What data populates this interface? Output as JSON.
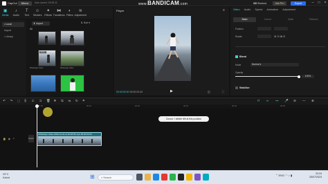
{
  "app": {
    "logo_label": "CapCut",
    "menu_label": "Menu",
    "autosave": "Auto saved: 23:05:11"
  },
  "watermark": {
    "prefix": "www.",
    "main": "BANDICAM",
    "suffix": ".com"
  },
  "header": {
    "shortcut_label": "Shortcut",
    "join_pro_label": "Join Pro",
    "export_label": "Export"
  },
  "media_tabs": [
    {
      "label": "Media",
      "icon": "media-icon",
      "glyph": "▣"
    },
    {
      "label": "Audio",
      "icon": "audio-icon",
      "glyph": "♪"
    },
    {
      "label": "Text",
      "icon": "text-icon",
      "glyph": "T"
    },
    {
      "label": "Stickers",
      "icon": "sticker-icon",
      "glyph": "☺"
    },
    {
      "label": "Effects",
      "icon": "effects-icon",
      "glyph": "✦"
    },
    {
      "label": "Transitions",
      "icon": "transition-icon",
      "glyph": "⧓"
    },
    {
      "label": "Filters",
      "icon": "filter-icon",
      "glyph": "◐"
    },
    {
      "label": "Adjustment",
      "icon": "adjust-icon",
      "glyph": "≋"
    }
  ],
  "left_nav": [
    {
      "label": "• Local",
      "active": true
    },
    {
      "label": "Import",
      "active": false
    },
    {
      "label": "• Library",
      "active": false
    }
  ],
  "media_panel": {
    "import_label": "Import",
    "sort_label": "Sort",
    "all_label": "All",
    "thumbnails": [
      {
        "label": "",
        "added": false
      },
      {
        "label": "",
        "added": false
      },
      {
        "label": "WhatsApp Video",
        "added": true
      },
      {
        "label": "WhatsApp Video",
        "added": false
      },
      {
        "label": "",
        "added": false
      },
      {
        "label": "",
        "added": false
      }
    ],
    "added_badge": "Added"
  },
  "player": {
    "title": "Player",
    "current_time": "00:00:00:00",
    "total_time": "00:00:03:43"
  },
  "properties": {
    "tabs": [
      "Video",
      "Audio",
      "Speed",
      "Animation",
      "Adjustment"
    ],
    "active_tab": "Video",
    "subtabs": [
      "Basic",
      "Cutout",
      "Mask",
      "Retouch"
    ],
    "active_subtab": "Basic",
    "position_label": "Position",
    "rotate_label": "Rotate",
    "blend_label": "Blend",
    "mode_label": "Mode",
    "mode_value": "Normal",
    "opacity_label": "Opacity",
    "opacity_value": "100%",
    "opacity_fraction": 1.0,
    "stabilize_label": "Stabilize"
  },
  "timeline": {
    "ruler_ticks": [
      "00:00",
      "00:10",
      "00:20",
      "00:30",
      "00:40",
      "00:50",
      "01:00"
    ],
    "tooltip": "Cursor: I delete left at this position",
    "clip_label": "WhatsApp Video 2022-12-24 at 20:48:05.mp4 00:00:04:03",
    "cover_label": "Cover",
    "toolbar_icons": [
      "undo-icon",
      "redo-icon",
      "select-icon",
      "split-icon",
      "delete-left-icon",
      "delete-right-icon",
      "delete-icon",
      "freeze-icon",
      "reverse-icon",
      "mirror-icon",
      "rotate-icon",
      "crop-icon"
    ],
    "toolbar_glyphs": [
      "↶",
      "↷",
      "⬚",
      "⫼",
      "⊏",
      "⊐",
      "🗑",
      "❄",
      "⇆",
      "⇋",
      "↻",
      "⌗"
    ],
    "right_icons": [
      "magnet-icon",
      "link-icon",
      "preview-axis-icon",
      "mic-icon",
      "zoom-out-icon",
      "zoom-slider",
      "zoom-in-icon"
    ],
    "right_glyphs": [
      "⊓",
      "∞",
      "⊶",
      "🎤",
      "⊖",
      "—",
      "⊕"
    ]
  },
  "taskbar": {
    "weather_temp": "29°C",
    "weather_desc": "Kabut",
    "search_placeholder": "Search",
    "tray_lang": "ENG",
    "time": "23:24",
    "date": "25/07/2023"
  },
  "colors": {
    "accent": "#3fd0dc",
    "export": "#2e6be6",
    "panel": "#1b1b1b",
    "clip": "#1f6f7c"
  }
}
